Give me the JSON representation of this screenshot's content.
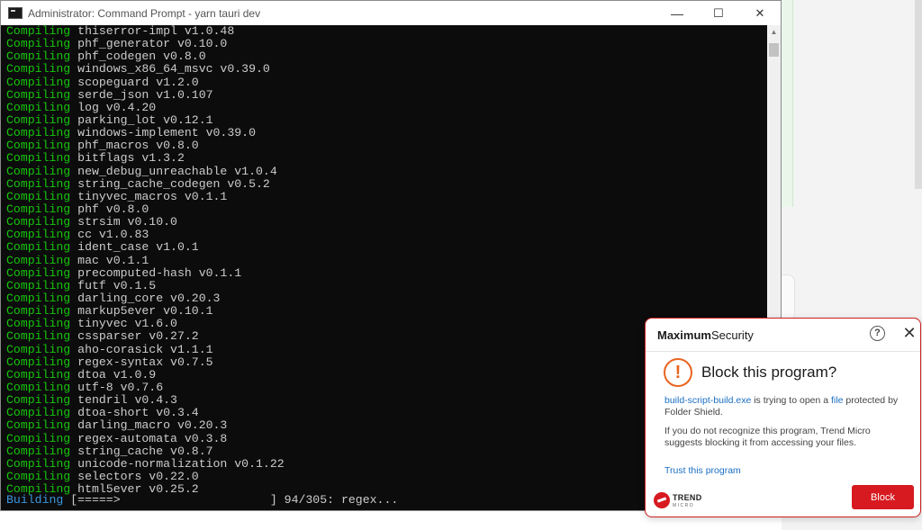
{
  "window": {
    "title": "Administrator: Command Prompt - yarn  tauri dev",
    "controls": {
      "minimize": "—",
      "maximize": "☐",
      "close": "✕"
    }
  },
  "terminal": {
    "keyword": "Compiling",
    "lines": [
      "thiserror-impl v1.0.48",
      "phf_generator v0.10.0",
      "phf_codegen v0.8.0",
      "windows_x86_64_msvc v0.39.0",
      "scopeguard v1.2.0",
      "serde_json v1.0.107",
      "log v0.4.20",
      "parking_lot v0.12.1",
      "windows-implement v0.39.0",
      "phf_macros v0.8.0",
      "bitflags v1.3.2",
      "new_debug_unreachable v1.0.4",
      "string_cache_codegen v0.5.2",
      "tinyvec_macros v0.1.1",
      "phf v0.8.0",
      "strsim v0.10.0",
      "cc v1.0.83",
      "ident_case v1.0.1",
      "mac v0.1.1",
      "precomputed-hash v0.1.1",
      "futf v0.1.5",
      "darling_core v0.20.3",
      "markup5ever v0.10.1",
      "tinyvec v1.6.0",
      "cssparser v0.27.2",
      "aho-corasick v1.1.1",
      "regex-syntax v0.7.5",
      "dtoa v1.0.9",
      "utf-8 v0.7.6",
      "tendril v0.4.3",
      "dtoa-short v0.3.4",
      "darling_macro v0.20.3",
      "regex-automata v0.3.8",
      "string_cache v0.8.7",
      "unicode-normalization v0.1.22",
      "selectors v0.22.0",
      "html5ever v0.25.2"
    ],
    "status": {
      "keyword": "Building",
      "bar": "[=====>                     ]",
      "progress": "94/305: regex..."
    }
  },
  "popup": {
    "brand_prefix": "Maximum",
    "brand_suffix": "Security",
    "help": "?",
    "close": "✕",
    "warning_glyph": "!",
    "title": "Block this program?",
    "program": "build-script-build.exe",
    "msg_mid": " is trying to open a ",
    "file_link": "file",
    "msg_end": " protected by Folder Shield.",
    "advice": "If you do not recognize this program, Trend Micro suggests blocking it from accessing your files.",
    "trust_link": "Trust this program",
    "logo_line1": "TREND",
    "logo_line2": "MICRO",
    "block_button": "Block",
    "accent_color": "#d71920",
    "warning_color": "#e9641e"
  }
}
